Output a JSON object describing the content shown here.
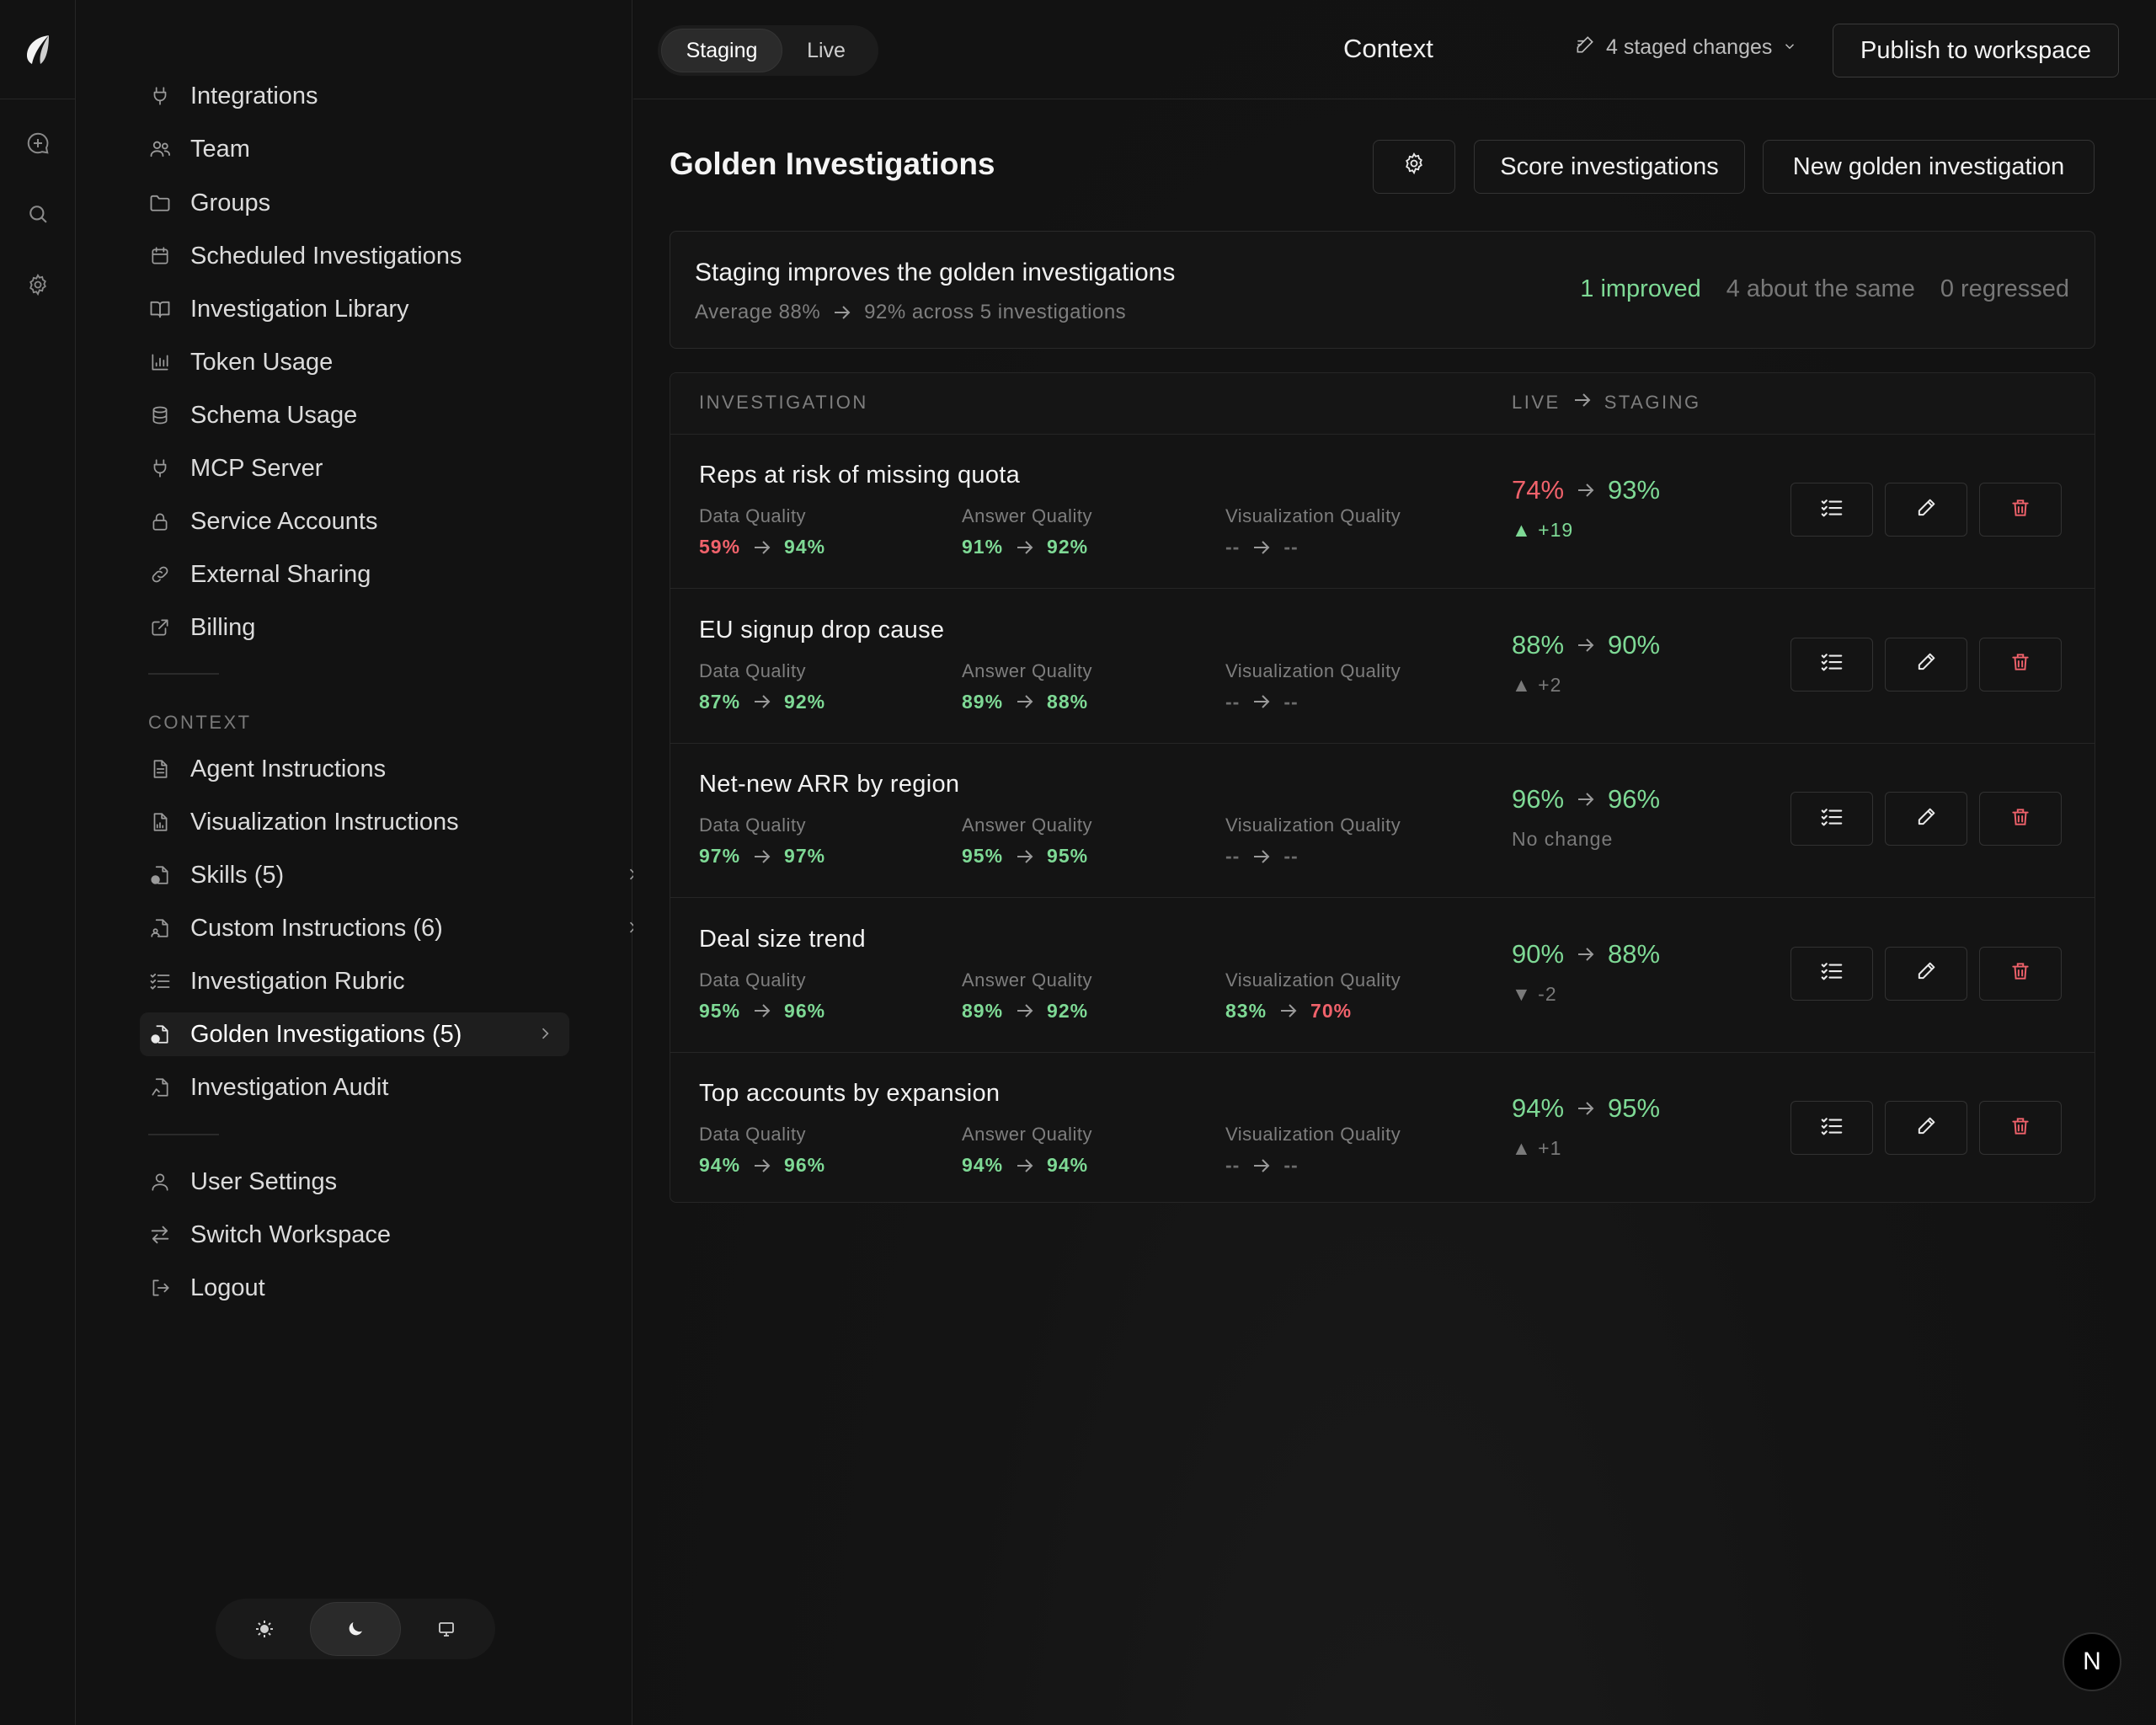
{
  "environment": {
    "options": [
      "Staging",
      "Live"
    ],
    "active": "Staging"
  },
  "header": {
    "title": "Context",
    "staged_changes": "4 staged changes",
    "publish_label": "Publish to workspace"
  },
  "sidebar": {
    "top_items": [
      {
        "label": "Integrations",
        "icon": "plug-icon"
      },
      {
        "label": "Team",
        "icon": "users-icon"
      },
      {
        "label": "Groups",
        "icon": "folder-icon"
      },
      {
        "label": "Scheduled Investigations",
        "icon": "calendar-icon"
      },
      {
        "label": "Investigation Library",
        "icon": "book-icon"
      },
      {
        "label": "Token Usage",
        "icon": "chart-icon"
      },
      {
        "label": "Schema Usage",
        "icon": "database-icon"
      },
      {
        "label": "MCP Server",
        "icon": "plug-icon"
      },
      {
        "label": "Service Accounts",
        "icon": "lock-icon"
      },
      {
        "label": "External Sharing",
        "icon": "link-icon"
      },
      {
        "label": "Billing",
        "icon": "external-icon"
      }
    ],
    "context_heading": "CONTEXT",
    "context_items": [
      {
        "label": "Agent Instructions",
        "icon": "document-icon"
      },
      {
        "label": "Visualization Instructions",
        "icon": "document-chart-icon"
      },
      {
        "label": "Skills (5)",
        "icon": "document-check-icon",
        "chevron": true
      },
      {
        "label": "Custom Instructions (6)",
        "icon": "document-user-icon",
        "chevron": true
      },
      {
        "label": "Investigation Rubric",
        "icon": "checklist-icon"
      },
      {
        "label": "Golden Investigations (5)",
        "icon": "document-star-icon",
        "chevron": true,
        "active": true
      },
      {
        "label": "Investigation Audit",
        "icon": "document-audit-icon"
      }
    ],
    "bottom_items": [
      {
        "label": "User Settings",
        "icon": "user-icon"
      },
      {
        "label": "Switch Workspace",
        "icon": "swap-icon"
      },
      {
        "label": "Logout",
        "icon": "logout-icon"
      }
    ],
    "theme_options": [
      "sun-icon",
      "moon-icon",
      "monitor-icon"
    ],
    "theme_active": "moon-icon"
  },
  "page": {
    "title": "Golden Investigations",
    "score_label": "Score investigations",
    "new_label": "New golden investigation"
  },
  "summary": {
    "headline": "Staging improves the golden investigations",
    "average_prefix": "Average 88%",
    "average_suffix": "92% across 5 investigations",
    "improved": "1 improved",
    "same": "4 about the same",
    "regressed": "0 regressed"
  },
  "table": {
    "col_investigation": "INVESTIGATION",
    "col_live": "LIVE",
    "col_staging": "STAGING",
    "metric_labels": [
      "Data Quality",
      "Answer Quality",
      "Visualization Quality"
    ],
    "rows": [
      {
        "name": "Reps at risk of missing quota",
        "metrics": [
          {
            "from": "59%",
            "to": "94%",
            "from_tone": "red",
            "to_tone": "green"
          },
          {
            "from": "91%",
            "to": "92%",
            "from_tone": "green",
            "to_tone": "green"
          },
          {
            "from": "--",
            "to": "--",
            "from_tone": "muted",
            "to_tone": "muted"
          }
        ],
        "live": "74%",
        "live_tone": "red",
        "staging": "93%",
        "staging_tone": "green",
        "delta": "▲ +19",
        "delta_tone": "green"
      },
      {
        "name": "EU signup drop cause",
        "metrics": [
          {
            "from": "87%",
            "to": "92%",
            "from_tone": "green",
            "to_tone": "green"
          },
          {
            "from": "89%",
            "to": "88%",
            "from_tone": "green",
            "to_tone": "green"
          },
          {
            "from": "--",
            "to": "--",
            "from_tone": "muted",
            "to_tone": "muted"
          }
        ],
        "live": "88%",
        "live_tone": "green",
        "staging": "90%",
        "staging_tone": "green",
        "delta": "▲ +2",
        "delta_tone": "muted"
      },
      {
        "name": "Net-new ARR by region",
        "metrics": [
          {
            "from": "97%",
            "to": "97%",
            "from_tone": "green",
            "to_tone": "green"
          },
          {
            "from": "95%",
            "to": "95%",
            "from_tone": "green",
            "to_tone": "green"
          },
          {
            "from": "--",
            "to": "--",
            "from_tone": "muted",
            "to_tone": "muted"
          }
        ],
        "live": "96%",
        "live_tone": "green",
        "staging": "96%",
        "staging_tone": "green",
        "delta": "No change",
        "delta_tone": "muted"
      },
      {
        "name": "Deal size trend",
        "metrics": [
          {
            "from": "95%",
            "to": "96%",
            "from_tone": "green",
            "to_tone": "green"
          },
          {
            "from": "89%",
            "to": "92%",
            "from_tone": "green",
            "to_tone": "green"
          },
          {
            "from": "83%",
            "to": "70%",
            "from_tone": "green",
            "to_tone": "red"
          }
        ],
        "live": "90%",
        "live_tone": "green",
        "staging": "88%",
        "staging_tone": "green",
        "delta": "▼ -2",
        "delta_tone": "muted"
      },
      {
        "name": "Top accounts by expansion",
        "metrics": [
          {
            "from": "94%",
            "to": "96%",
            "from_tone": "green",
            "to_tone": "green"
          },
          {
            "from": "94%",
            "to": "94%",
            "from_tone": "green",
            "to_tone": "green"
          },
          {
            "from": "--",
            "to": "--",
            "from_tone": "muted",
            "to_tone": "muted"
          }
        ],
        "live": "94%",
        "live_tone": "green",
        "staging": "95%",
        "staging_tone": "green",
        "delta": "▲ +1",
        "delta_tone": "muted"
      }
    ],
    "row_actions": [
      "checklist-icon",
      "pencil-icon",
      "trash-icon"
    ]
  },
  "badge": "N",
  "colors": {
    "good": "#7ed995",
    "bad": "#f0626b",
    "muted": "#6d6d6d",
    "background": "#111111"
  }
}
